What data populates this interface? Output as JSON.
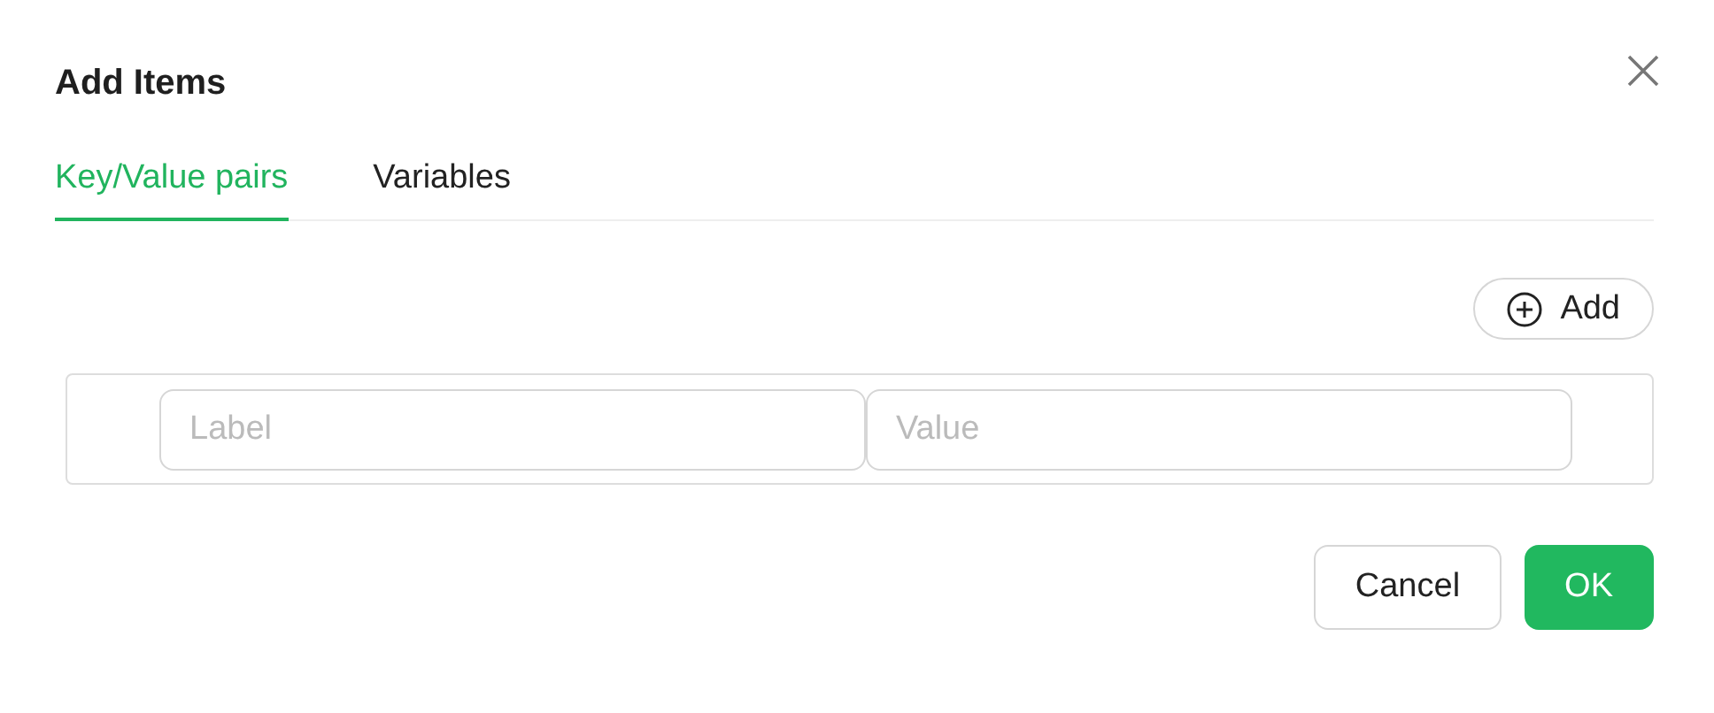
{
  "dialog": {
    "title": "Add Items"
  },
  "tabs": [
    {
      "label": "Key/Value pairs",
      "selected": true
    },
    {
      "label": "Variables",
      "selected": false
    }
  ],
  "add_button": {
    "label": "Add"
  },
  "rows": [
    {
      "label_placeholder": "Label",
      "value_placeholder": "Value"
    }
  ],
  "buttons": [
    {
      "label": "Cancel",
      "kind": "secondary"
    },
    {
      "label": "OK",
      "kind": "primary"
    }
  ]
}
